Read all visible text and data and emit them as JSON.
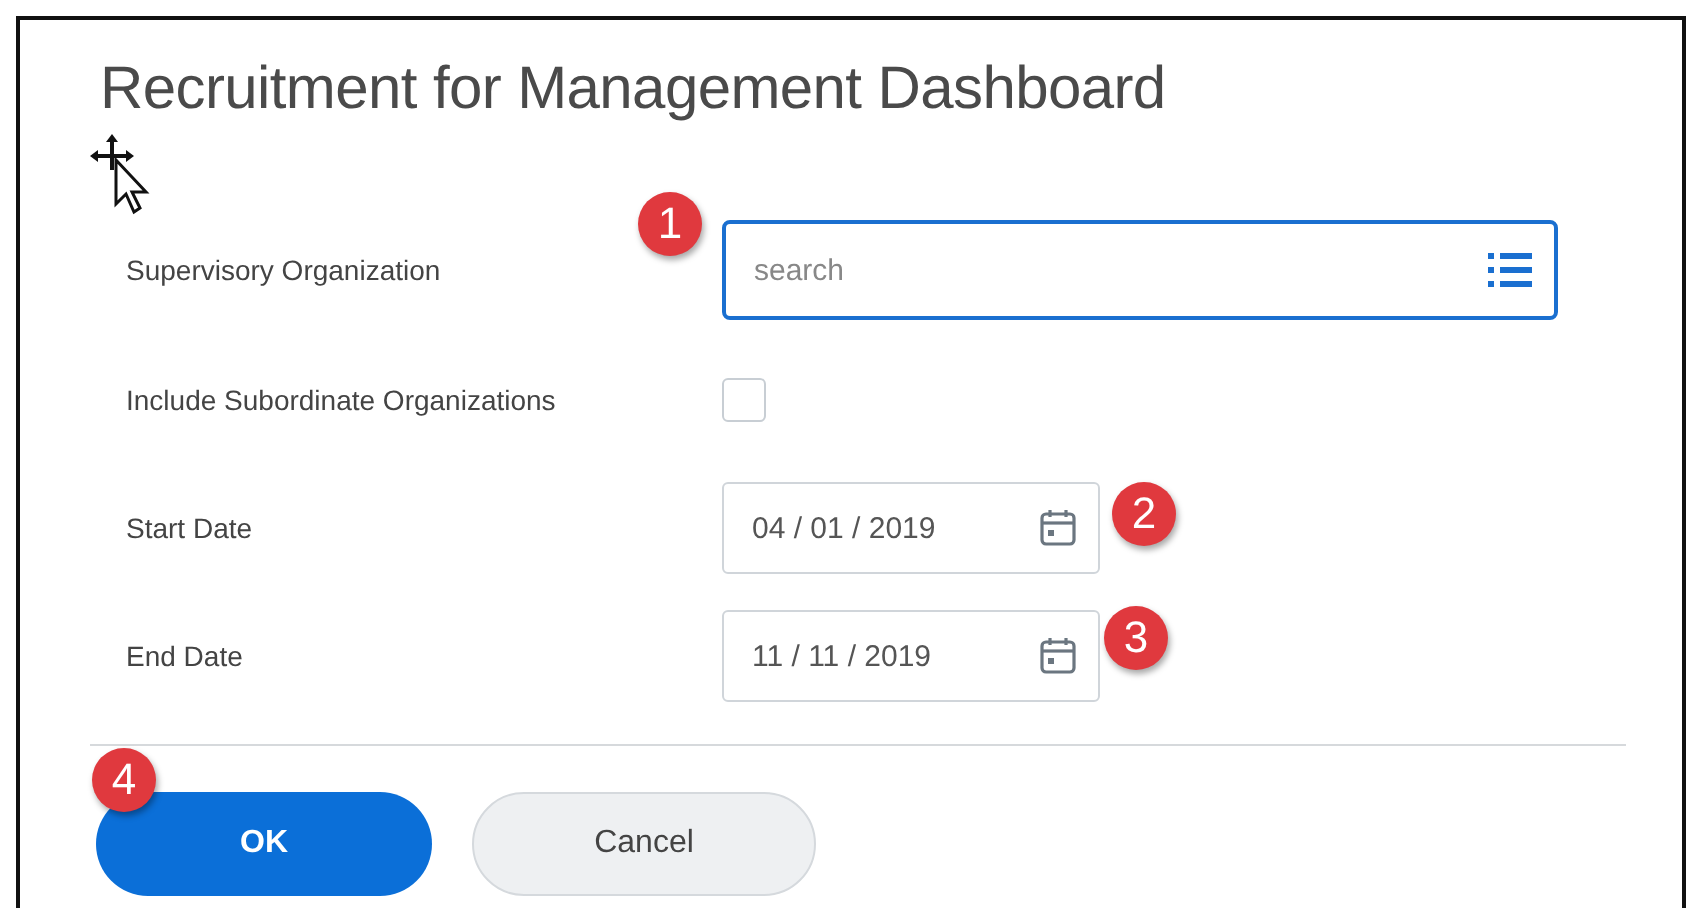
{
  "dialog": {
    "title": "Recruitment for Management Dashboard"
  },
  "fields": [
    {
      "kind": "search",
      "label": "Supervisory Organization",
      "placeholder": "search",
      "badge": "1"
    },
    {
      "kind": "checkbox",
      "label": "Include Subordinate Organizations",
      "checked": false
    },
    {
      "kind": "date",
      "label": "Start Date",
      "value": "04 / 01 / 2019",
      "badge": "2"
    },
    {
      "kind": "date",
      "label": "End Date",
      "value": "11 / 11 / 2019",
      "badge": "3"
    }
  ],
  "buttons": [
    {
      "kind": "primary",
      "label": "OK",
      "badge": "4"
    },
    {
      "kind": "secondary",
      "label": "Cancel"
    }
  ]
}
